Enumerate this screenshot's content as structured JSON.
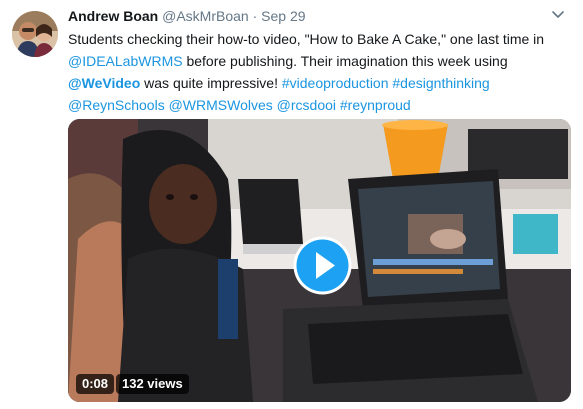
{
  "tweet": {
    "author_name": "Andrew Boan",
    "handle": "@AskMrBoan",
    "separator": "·",
    "date": "Sep 29",
    "text": {
      "line1": "Students checking their how-to video, \"How to Bake A Cake,\" one last time in",
      "line2_mention": "@IDEALabWRMS",
      "line2_text": " before publishing. Their imagination this week using",
      "line3_mention": "@WeVideo",
      "line3_text": " was quite impressive! ",
      "line3_hashtags": "#videoproduction #designthinking",
      "line4_mentions": "@ReynSchools @WRMSWolves @rcsdooi #reynproud"
    }
  },
  "video": {
    "duration": "0:08",
    "views": "132 views"
  },
  "colors": {
    "link": "#1b95e0",
    "play_button": "#1da1f2"
  },
  "icons": {
    "menu": "chevron-down-icon",
    "play": "play-icon"
  }
}
